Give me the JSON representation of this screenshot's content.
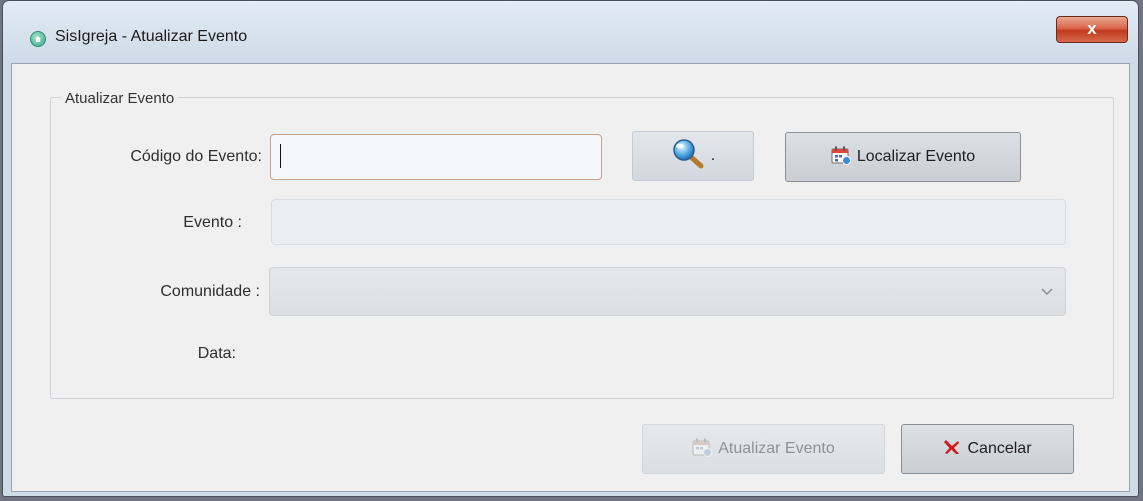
{
  "window": {
    "title": "SisIgreja - Atualizar Evento",
    "close_label": "x"
  },
  "form": {
    "group_title": "Atualizar Evento",
    "code_label": "Código do Evento:",
    "code_value": "",
    "event_label": "Evento :",
    "event_value": "",
    "community_label": "Comunidade :",
    "community_selected": "",
    "date_label": "Data:",
    "search_button_label": ".",
    "locate_button_label": "Localizar Evento"
  },
  "actions": {
    "update_label": "Atualizar Evento",
    "cancel_label": "Cancelar"
  },
  "icons": {
    "app": "house-icon",
    "search": "magnifier-icon",
    "calendar": "calendar-icon",
    "cancel": "red-x-icon"
  },
  "colors": {
    "close_button": "#c9452a",
    "cancel_x": "#d01818",
    "code_input_border": "#c7a48c"
  }
}
